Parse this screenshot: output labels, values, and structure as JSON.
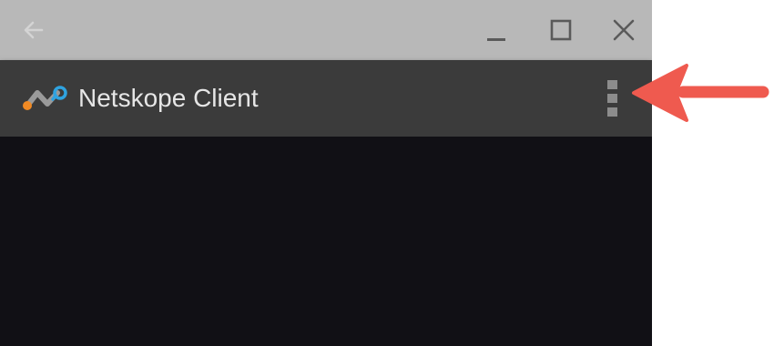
{
  "window": {
    "icons": {
      "back": "arrow-left-icon",
      "minimize": "minimize-icon",
      "maximize": "maximize-icon",
      "close": "close-icon"
    }
  },
  "appbar": {
    "title": "Netskope Client",
    "logo_icon": "netskope-logo-icon",
    "menu_icon": "more-vertical-icon"
  },
  "annotation": {
    "arrow_icon": "arrow-left-icon"
  },
  "colors": {
    "titlebar": "#b8b8b8",
    "appbar": "#3b3b3b",
    "content": "#111015",
    "logo_orange": "#f08a24",
    "logo_gray": "#9a9a9a",
    "logo_blue": "#2fa3e0",
    "annotation_arrow": "#ef5a4f"
  }
}
